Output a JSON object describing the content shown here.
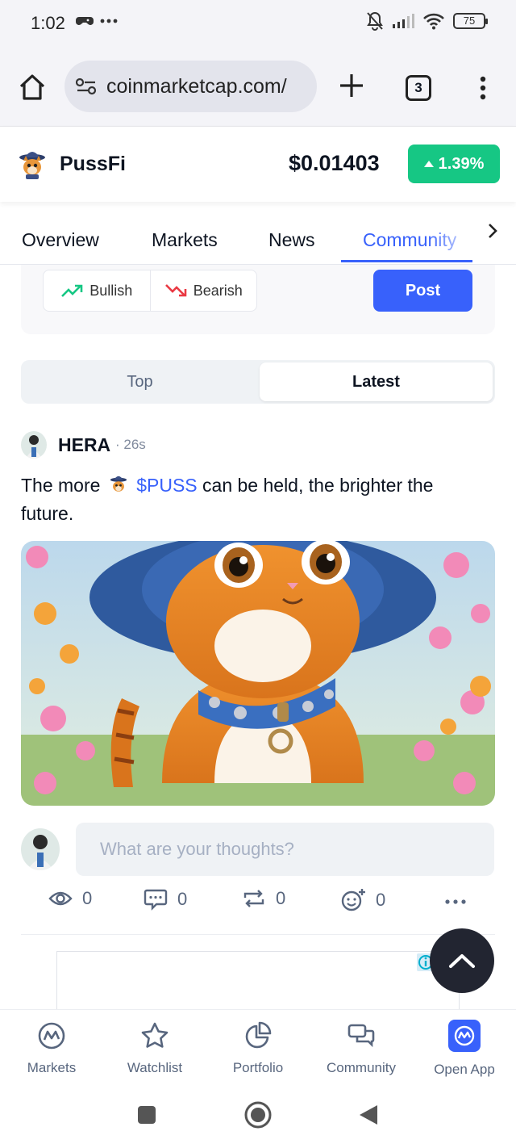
{
  "status_bar": {
    "time": "1:02",
    "battery": "75"
  },
  "browser": {
    "url": "coinmarketcap.com/",
    "tab_count": "3"
  },
  "coin": {
    "name": "PussFi",
    "price": "$0.01403",
    "change": "1.39%"
  },
  "tabs": [
    {
      "label": "Overview"
    },
    {
      "label": "Markets"
    },
    {
      "label": "News"
    },
    {
      "label": "Community"
    }
  ],
  "sentiment": {
    "bullish": "Bullish",
    "bearish": "Bearish",
    "post": "Post"
  },
  "feed_toggle": {
    "top": "Top",
    "latest": "Latest"
  },
  "post": {
    "author": "HERA",
    "time": "· 26s",
    "text_before": "The more",
    "cashtag": "$PUSS",
    "text_after": "can be held, the brighter the future.",
    "comment_placeholder": "What are your thoughts?",
    "views": "0",
    "comments": "0",
    "reposts": "0",
    "reactions": "0"
  },
  "bottom_nav": [
    {
      "label": "Markets",
      "icon": "cmc-logo-icon"
    },
    {
      "label": "Watchlist",
      "icon": "star-icon"
    },
    {
      "label": "Portfolio",
      "icon": "pie-chart-icon"
    },
    {
      "label": "Community",
      "icon": "chat-bubbles-icon"
    },
    {
      "label": "Open App",
      "icon": "app-logo-icon"
    }
  ],
  "colors": {
    "accent": "#3861fb",
    "positive": "#16c784",
    "negative": "#ea3943"
  }
}
